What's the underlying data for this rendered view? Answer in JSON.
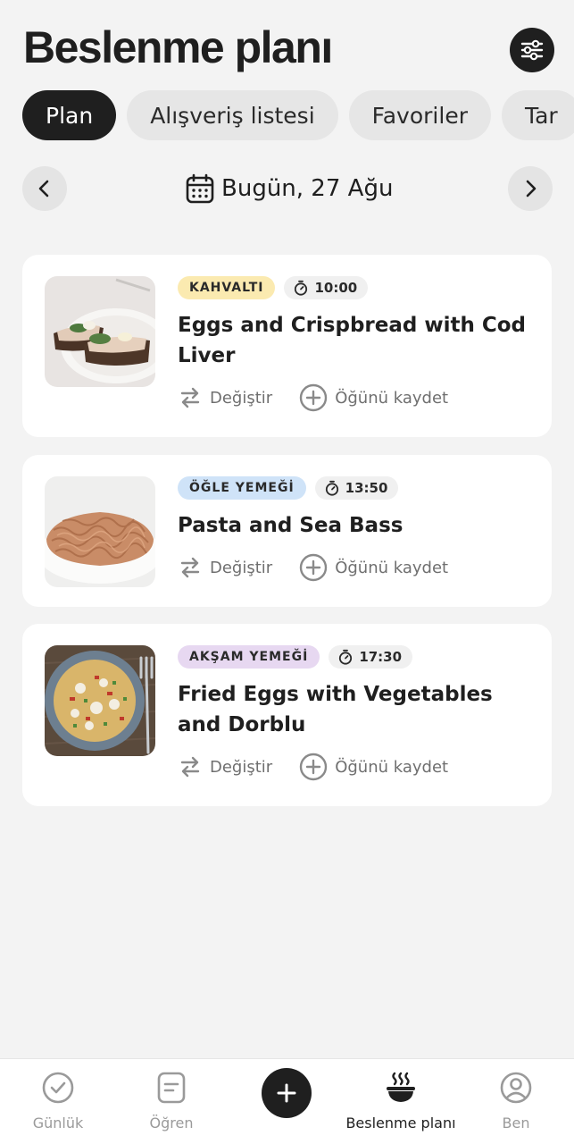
{
  "header": {
    "title": "Beslenme planı",
    "filter_icon": "sliders-icon"
  },
  "tabs": [
    {
      "label": "Plan",
      "active": true
    },
    {
      "label": "Alışveriş listesi",
      "active": false
    },
    {
      "label": "Favoriler",
      "active": false
    },
    {
      "label": "Tar",
      "active": false
    }
  ],
  "date_nav": {
    "label": "Bugün, 27 Ağu",
    "prev_icon": "chevron-left-icon",
    "next_icon": "chevron-right-icon",
    "calendar_icon": "calendar-icon"
  },
  "meals": [
    {
      "type": "KAHVALTI",
      "type_color": "#fbeab0",
      "time": "10:00",
      "title": "Eggs and Crispbread with Cod Liver",
      "image": "eggs-crispbread-photo",
      "swap_label": "Değiştir",
      "save_label": "Öğünü kaydet"
    },
    {
      "type": "ÖĞLE YEMEĞİ",
      "type_color": "#cfe3f8",
      "time": "13:50",
      "title": "Pasta and Sea Bass",
      "image": "pasta-photo",
      "swap_label": "Değiştir",
      "save_label": "Öğünü kaydet"
    },
    {
      "type": "AKŞAM YEMEĞİ",
      "type_color": "#e7d8f1",
      "time": "17:30",
      "title": "Fried Eggs with Vegetables and Dorblu",
      "image": "fried-eggs-vegetables-photo",
      "swap_label": "Değiştir",
      "save_label": "Öğünü kaydet"
    }
  ],
  "bottom_nav": [
    {
      "label": "Günlük",
      "icon": "check-circle-icon",
      "active": false
    },
    {
      "label": "Öğren",
      "icon": "notes-icon",
      "active": false
    },
    {
      "label": "",
      "icon": "plus-icon",
      "active": false
    },
    {
      "label": "Beslenme planı",
      "icon": "food-bowl-icon",
      "active": true
    },
    {
      "label": "Ben",
      "icon": "profile-icon",
      "active": false
    }
  ],
  "colors": {
    "background": "#f3f3f3",
    "primary_dark": "#1f1f1f",
    "muted_text": "#6f6f6f"
  }
}
